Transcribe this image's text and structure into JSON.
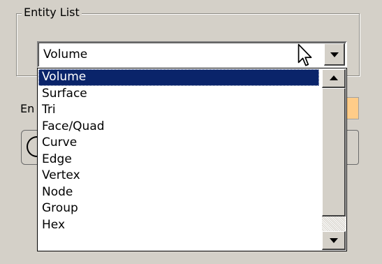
{
  "entity_list": {
    "group_title": "Entity List",
    "selected_value": "Volume",
    "options": [
      "Volume",
      "Surface",
      "Tri",
      "Face/Quad",
      "Curve",
      "Edge",
      "Vertex",
      "Node",
      "Group",
      "Hex"
    ],
    "selected_index": 0
  },
  "background": {
    "partial_label": "En",
    "partial_button_glyph": "("
  },
  "colors": {
    "window_background": "#d4d0c8",
    "selection_highlight": "#0a246a",
    "selection_text": "#ffffff",
    "field_background": "#ffcc88"
  },
  "icons": {
    "cursor": "arrow-pointer-icon",
    "dropdown_toggle": "chevron-down-icon",
    "scroll_up": "arrow-up-icon",
    "scroll_down": "arrow-down-icon"
  }
}
